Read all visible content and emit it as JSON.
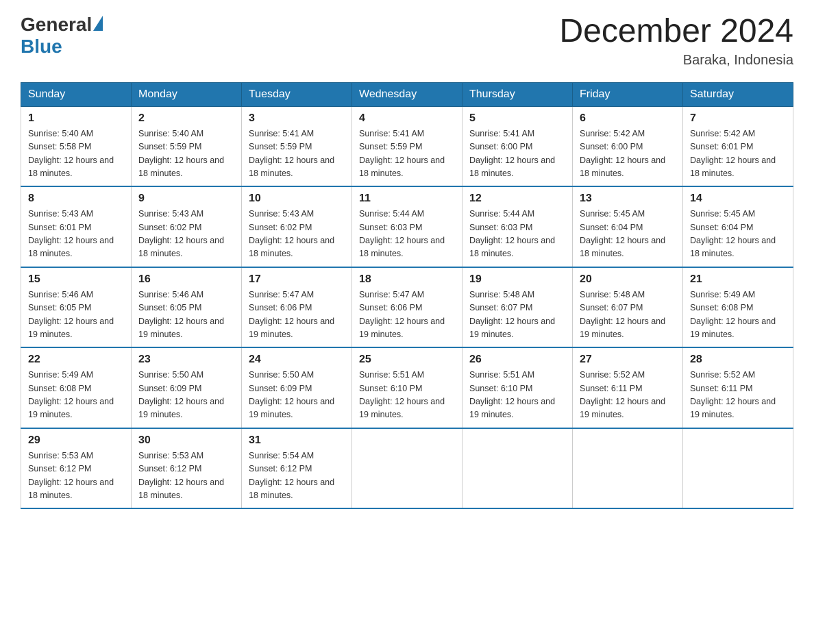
{
  "header": {
    "logo_general": "General",
    "logo_blue": "Blue",
    "month_title": "December 2024",
    "location": "Baraka, Indonesia"
  },
  "days_of_week": [
    "Sunday",
    "Monday",
    "Tuesday",
    "Wednesday",
    "Thursday",
    "Friday",
    "Saturday"
  ],
  "weeks": [
    [
      {
        "day": "1",
        "sunrise": "5:40 AM",
        "sunset": "5:58 PM",
        "daylight": "12 hours and 18 minutes"
      },
      {
        "day": "2",
        "sunrise": "5:40 AM",
        "sunset": "5:59 PM",
        "daylight": "12 hours and 18 minutes"
      },
      {
        "day": "3",
        "sunrise": "5:41 AM",
        "sunset": "5:59 PM",
        "daylight": "12 hours and 18 minutes"
      },
      {
        "day": "4",
        "sunrise": "5:41 AM",
        "sunset": "5:59 PM",
        "daylight": "12 hours and 18 minutes"
      },
      {
        "day": "5",
        "sunrise": "5:41 AM",
        "sunset": "6:00 PM",
        "daylight": "12 hours and 18 minutes"
      },
      {
        "day": "6",
        "sunrise": "5:42 AM",
        "sunset": "6:00 PM",
        "daylight": "12 hours and 18 minutes"
      },
      {
        "day": "7",
        "sunrise": "5:42 AM",
        "sunset": "6:01 PM",
        "daylight": "12 hours and 18 minutes"
      }
    ],
    [
      {
        "day": "8",
        "sunrise": "5:43 AM",
        "sunset": "6:01 PM",
        "daylight": "12 hours and 18 minutes"
      },
      {
        "day": "9",
        "sunrise": "5:43 AM",
        "sunset": "6:02 PM",
        "daylight": "12 hours and 18 minutes"
      },
      {
        "day": "10",
        "sunrise": "5:43 AM",
        "sunset": "6:02 PM",
        "daylight": "12 hours and 18 minutes"
      },
      {
        "day": "11",
        "sunrise": "5:44 AM",
        "sunset": "6:03 PM",
        "daylight": "12 hours and 18 minutes"
      },
      {
        "day": "12",
        "sunrise": "5:44 AM",
        "sunset": "6:03 PM",
        "daylight": "12 hours and 18 minutes"
      },
      {
        "day": "13",
        "sunrise": "5:45 AM",
        "sunset": "6:04 PM",
        "daylight": "12 hours and 18 minutes"
      },
      {
        "day": "14",
        "sunrise": "5:45 AM",
        "sunset": "6:04 PM",
        "daylight": "12 hours and 18 minutes"
      }
    ],
    [
      {
        "day": "15",
        "sunrise": "5:46 AM",
        "sunset": "6:05 PM",
        "daylight": "12 hours and 19 minutes"
      },
      {
        "day": "16",
        "sunrise": "5:46 AM",
        "sunset": "6:05 PM",
        "daylight": "12 hours and 19 minutes"
      },
      {
        "day": "17",
        "sunrise": "5:47 AM",
        "sunset": "6:06 PM",
        "daylight": "12 hours and 19 minutes"
      },
      {
        "day": "18",
        "sunrise": "5:47 AM",
        "sunset": "6:06 PM",
        "daylight": "12 hours and 19 minutes"
      },
      {
        "day": "19",
        "sunrise": "5:48 AM",
        "sunset": "6:07 PM",
        "daylight": "12 hours and 19 minutes"
      },
      {
        "day": "20",
        "sunrise": "5:48 AM",
        "sunset": "6:07 PM",
        "daylight": "12 hours and 19 minutes"
      },
      {
        "day": "21",
        "sunrise": "5:49 AM",
        "sunset": "6:08 PM",
        "daylight": "12 hours and 19 minutes"
      }
    ],
    [
      {
        "day": "22",
        "sunrise": "5:49 AM",
        "sunset": "6:08 PM",
        "daylight": "12 hours and 19 minutes"
      },
      {
        "day": "23",
        "sunrise": "5:50 AM",
        "sunset": "6:09 PM",
        "daylight": "12 hours and 19 minutes"
      },
      {
        "day": "24",
        "sunrise": "5:50 AM",
        "sunset": "6:09 PM",
        "daylight": "12 hours and 19 minutes"
      },
      {
        "day": "25",
        "sunrise": "5:51 AM",
        "sunset": "6:10 PM",
        "daylight": "12 hours and 19 minutes"
      },
      {
        "day": "26",
        "sunrise": "5:51 AM",
        "sunset": "6:10 PM",
        "daylight": "12 hours and 19 minutes"
      },
      {
        "day": "27",
        "sunrise": "5:52 AM",
        "sunset": "6:11 PM",
        "daylight": "12 hours and 19 minutes"
      },
      {
        "day": "28",
        "sunrise": "5:52 AM",
        "sunset": "6:11 PM",
        "daylight": "12 hours and 19 minutes"
      }
    ],
    [
      {
        "day": "29",
        "sunrise": "5:53 AM",
        "sunset": "6:12 PM",
        "daylight": "12 hours and 18 minutes"
      },
      {
        "day": "30",
        "sunrise": "5:53 AM",
        "sunset": "6:12 PM",
        "daylight": "12 hours and 18 minutes"
      },
      {
        "day": "31",
        "sunrise": "5:54 AM",
        "sunset": "6:12 PM",
        "daylight": "12 hours and 18 minutes"
      },
      null,
      null,
      null,
      null
    ]
  ]
}
